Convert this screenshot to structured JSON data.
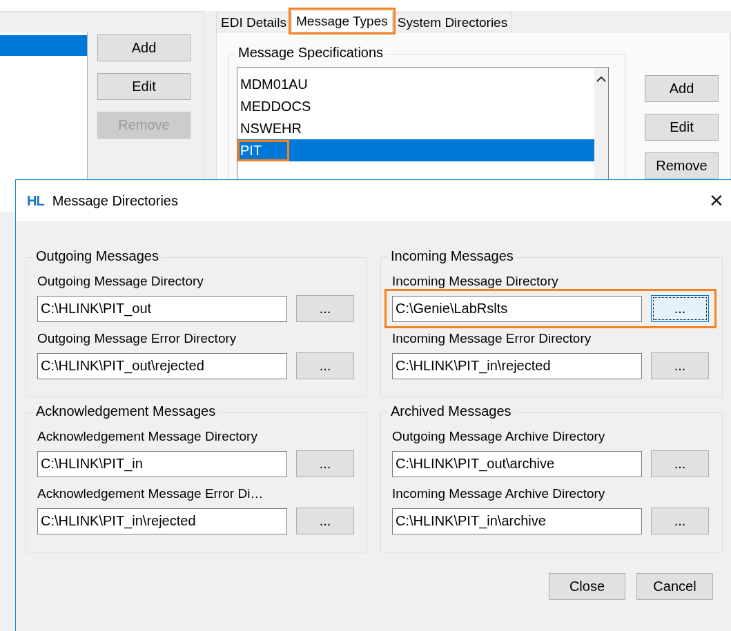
{
  "left_list": {
    "rows": [
      {
        "selected": true
      }
    ]
  },
  "left_buttons": [
    {
      "label": "Add",
      "disabled": false
    },
    {
      "label": "Edit",
      "disabled": false
    },
    {
      "label": "Remove",
      "disabled": true
    }
  ],
  "tabs": [
    {
      "label": "EDI Details",
      "selected": false,
      "highlighted": false
    },
    {
      "label": "Message Types",
      "selected": true,
      "highlighted": true
    },
    {
      "label": "System Directories",
      "selected": false,
      "highlighted": false
    }
  ],
  "message_specifications": {
    "title": "Message Specifications",
    "items": [
      {
        "label": "MDM01AU",
        "selected": false,
        "highlighted": false
      },
      {
        "label": "MEDDOCS",
        "selected": false,
        "highlighted": false
      },
      {
        "label": "NSWEHR",
        "selected": false,
        "highlighted": false
      },
      {
        "label": "PIT",
        "selected": true,
        "highlighted": true
      }
    ],
    "buttons": [
      {
        "label": "Add",
        "disabled": false
      },
      {
        "label": "Edit",
        "disabled": false
      },
      {
        "label": "Remove",
        "disabled": false
      }
    ]
  },
  "dialog": {
    "logo": "HL",
    "title": "Message Directories",
    "close": "✕",
    "groups": [
      {
        "title": "Outgoing Messages",
        "fields": [
          {
            "label": "Outgoing Message Directory",
            "value": "C:\\HLINK\\PIT_out",
            "browse": "...",
            "focused": false,
            "highlighted": false
          },
          {
            "label": "Outgoing Message Error Directory",
            "value": "C:\\HLINK\\PIT_out\\rejected",
            "browse": "...",
            "focused": false,
            "highlighted": false
          }
        ]
      },
      {
        "title": "Incoming Messages",
        "fields": [
          {
            "label": "Incoming Message Directory",
            "value": "C:\\Genie\\LabRslts",
            "browse": "...",
            "focused": true,
            "highlighted": true
          },
          {
            "label": "Incoming Message Error Directory",
            "value": "C:\\HLINK\\PIT_in\\rejected",
            "browse": "...",
            "focused": false,
            "highlighted": false
          }
        ]
      },
      {
        "title": "Acknowledgement Messages",
        "fields": [
          {
            "label": "Acknowledgement Message Directory",
            "value": "C:\\HLINK\\PIT_in",
            "browse": "...",
            "focused": false,
            "highlighted": false
          },
          {
            "label": "Acknowledgement Message Error Di…",
            "value": "C:\\HLINK\\PIT_in\\rejected",
            "browse": "...",
            "focused": false,
            "highlighted": false
          }
        ]
      },
      {
        "title": "Archived Messages",
        "fields": [
          {
            "label": "Outgoing Message Archive Directory",
            "value": "C:\\HLINK\\PIT_out\\archive",
            "browse": "...",
            "focused": false,
            "highlighted": false
          },
          {
            "label": "Incoming Message Archive Directory",
            "value": "C:\\HLINK\\PIT_in\\archive",
            "browse": "...",
            "focused": false,
            "highlighted": false
          }
        ]
      }
    ],
    "buttons": [
      {
        "label": "Close"
      },
      {
        "label": "Cancel"
      }
    ]
  }
}
